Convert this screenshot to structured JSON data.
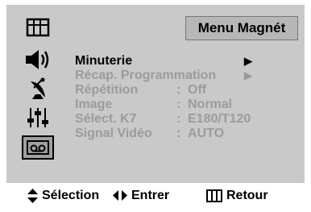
{
  "menu": {
    "title": "Menu Magnét",
    "items": [
      {
        "label": "Minuterie",
        "separator": "",
        "value": "",
        "arrow": "▶",
        "active": true
      },
      {
        "label": "Récap. Programmation",
        "separator": "",
        "value": "",
        "arrow": "▶",
        "active": false
      },
      {
        "label": "Répétition",
        "separator": ":",
        "value": "Off",
        "arrow": "",
        "active": false
      },
      {
        "label": "Image",
        "separator": ":",
        "value": "Normal",
        "arrow": "",
        "active": false
      },
      {
        "label": "Sélect. K7",
        "separator": ":",
        "value": "E180/T120",
        "arrow": "",
        "active": false
      },
      {
        "label": "Signal Vidéo",
        "separator": ":",
        "value": "AUTO",
        "arrow": "",
        "active": false
      }
    ]
  },
  "side_icons": [
    "picture-icon",
    "sound-icon",
    "satellite-icon",
    "equalizer-icon",
    "tape-icon"
  ],
  "footer": {
    "select_label": "Sélection",
    "enter_label": "Entrer",
    "return_label": "Retour"
  },
  "colors": {
    "panel": "#c9c9c9",
    "title_box": "#b7b7b7",
    "active_text": "#000000",
    "inactive_text": "#9b9b9b"
  }
}
